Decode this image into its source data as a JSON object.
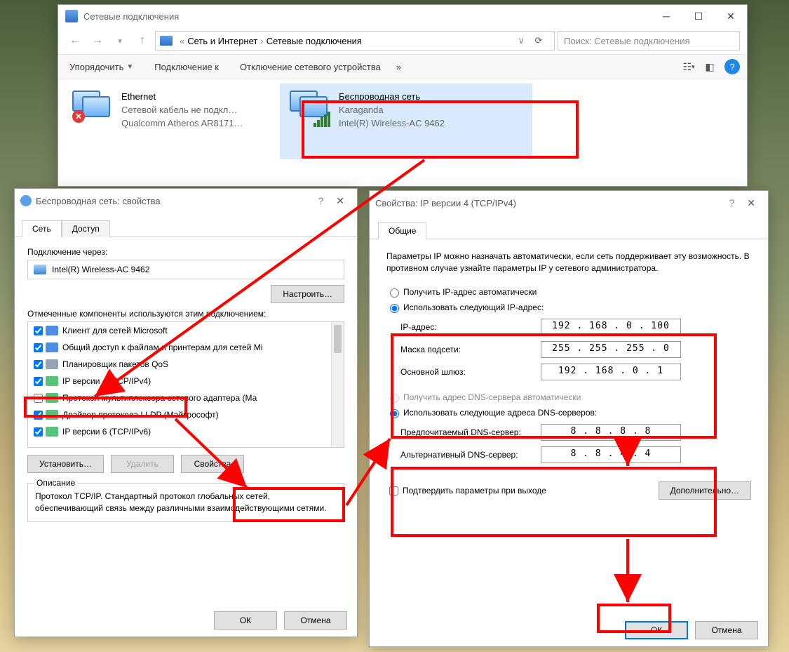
{
  "explorer": {
    "title": "Сетевые подключения",
    "breadcrumb": {
      "a": "«",
      "b": "Сеть и Интернет",
      "c": "Сетевые подключения"
    },
    "search_placeholder": "Поиск: Сетевые подключения",
    "toolbar": {
      "organize": "Упорядочить",
      "connect": "Подключение к",
      "disable": "Отключение сетевого устройства",
      "more": "»"
    },
    "adapters": {
      "eth": {
        "name": "Ethernet",
        "status": "Сетевой кабель не подкл…",
        "driver": "Qualcomm Atheros AR8171…"
      },
      "wifi": {
        "name": "Беспроводная сеть",
        "status": "Karaganda",
        "driver": "Intel(R) Wireless-AC 9462"
      }
    }
  },
  "dlg1": {
    "title": "Беспроводная сеть: свойства",
    "tabs": {
      "net": "Сеть",
      "access": "Доступ"
    },
    "conn_thru": "Подключение через:",
    "nic": "Intel(R) Wireless-AC 9462",
    "configure": "Настроить…",
    "components": "Отмеченные компоненты используются этим подключением:",
    "items": {
      "c1": "Клиент для сетей Microsoft",
      "c2": "Общий доступ к файлам и принтерам для сетей Mi",
      "c3": "Планировщик пакетов QoS",
      "c4": "IP версии 4 (TCP/IPv4)",
      "c5": "Протокол мультиплексора сетевого адаптера (Ма",
      "c6": "Драйвер протокола LLDP (Майкрософт)",
      "c7": "IP версии 6 (TCP/IPv6)"
    },
    "install": "Установить…",
    "remove": "Удалить",
    "props": "Свойства",
    "desc_legend": "Описание",
    "desc": "Протокол TCP/IP. Стандартный протокол глобальных сетей, обеспечивающий связь между различными взаимодействующими сетями.",
    "ok": "ОК",
    "cancel": "Отмена"
  },
  "dlg2": {
    "title": "Свойства: IP версии 4 (TCP/IPv4)",
    "tab": "Общие",
    "intro": "Параметры IP можно назначать автоматически, если сеть поддерживает эту возможность. В противном случае узнайте параметры IP у сетевого администратора.",
    "r_auto_ip": "Получить IP-адрес автоматически",
    "r_manual_ip": "Использовать следующий IP-адрес:",
    "ip_label": "IP-адрес:",
    "mask_label": "Маска подсети:",
    "gw_label": "Основной шлюз:",
    "ip": "192 . 168 .   0  . 100",
    "mask": "255 . 255 . 255 .   0",
    "gw": "192 . 168 .   0  .   1",
    "r_auto_dns": "Получить адрес DNS-сервера автоматически",
    "r_manual_dns": "Использовать следующие адреса DNS-серверов:",
    "dns1_label": "Предпочитаемый DNS-сервер:",
    "dns2_label": "Альтернативный DNS-сервер:",
    "dns1": "8  .  8  .  8  .  8",
    "dns2": "8  .  8  .  4  .  4",
    "validate": "Подтвердить параметры при выходе",
    "advanced": "Дополнительно…",
    "ok": "ОК",
    "cancel": "Отмена"
  }
}
